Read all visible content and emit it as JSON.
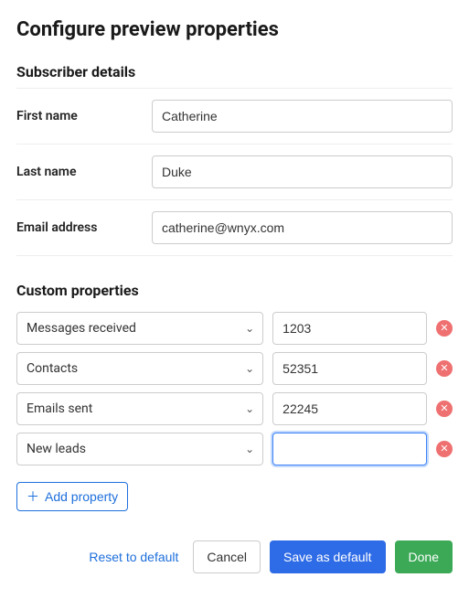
{
  "title": "Configure preview properties",
  "subscriber": {
    "heading": "Subscriber details",
    "fields": {
      "first_name": {
        "label": "First name",
        "value": "Catherine"
      },
      "last_name": {
        "label": "Last name",
        "value": "Duke"
      },
      "email": {
        "label": "Email address",
        "value": "catherine@wnyx.com"
      }
    }
  },
  "custom": {
    "heading": "Custom properties",
    "rows": [
      {
        "property": "Messages received",
        "value": "1203"
      },
      {
        "property": "Contacts",
        "value": "52351"
      },
      {
        "property": "Emails sent",
        "value": "22245"
      },
      {
        "property": "New leads",
        "value": ""
      }
    ],
    "add_label": "Add property"
  },
  "footer": {
    "reset": "Reset to default",
    "cancel": "Cancel",
    "save_default": "Save as default",
    "done": "Done"
  },
  "icons": {
    "remove": "✕",
    "add": "＋",
    "chevron": "⌄"
  }
}
